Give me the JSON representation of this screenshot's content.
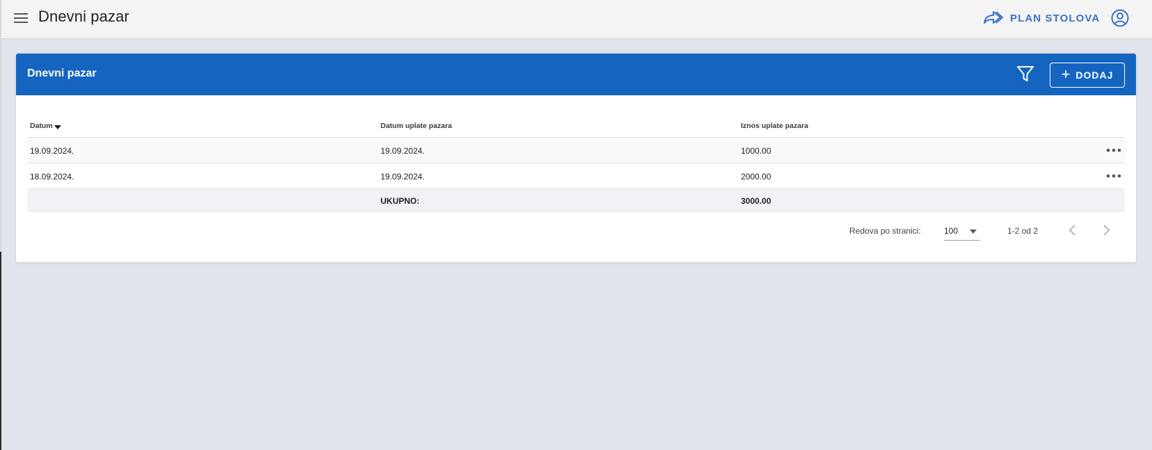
{
  "app": {
    "title": "Dnevni pazar",
    "plan_label": "PLAN STOLOVA"
  },
  "card": {
    "title": "Dnevni pazar",
    "add_label": "DODAJ"
  },
  "table": {
    "columns": [
      "Datum",
      "Datum uplate pazara",
      "Iznos uplate pazara"
    ],
    "sort": {
      "column": "Datum",
      "direction": "desc"
    },
    "rows": [
      {
        "datum": "19.09.2024.",
        "datum_uplate": "19.09.2024.",
        "iznos": "1000.00"
      },
      {
        "datum": "18.09.2024.",
        "datum_uplate": "19.09.2024.",
        "iznos": "2000.00"
      }
    ],
    "total": {
      "label": "UKUPNO:",
      "value": "3000.00"
    }
  },
  "pagination": {
    "rows_per_page_label": "Redova po stranici:",
    "rows_per_page": "100",
    "range": "1-2 od 2"
  },
  "colors": {
    "header_blue": "#1565c0",
    "accent_blue": "#3a72c8",
    "background": "#e1e4ec",
    "topbar": "#f4f4f4"
  },
  "icons": [
    "menu-icon",
    "share-forward-icon",
    "account-circle-icon",
    "filter-icon",
    "plus-icon",
    "sort-down-icon",
    "more-horizontal-icon",
    "chevron-left-icon",
    "chevron-right-icon",
    "caret-down-icon"
  ]
}
